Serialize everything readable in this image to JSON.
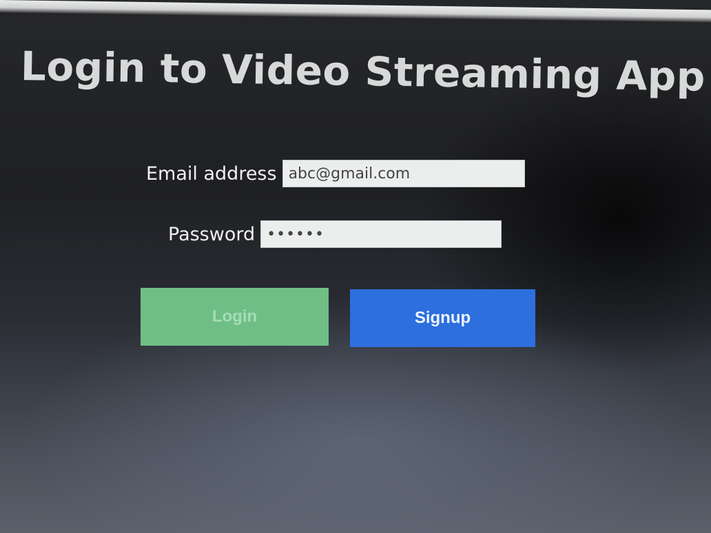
{
  "app": {
    "title": "Login to Video Streaming App"
  },
  "form": {
    "email": {
      "label": "Email address",
      "value": "abc@gmail.com"
    },
    "password": {
      "label": "Password",
      "value": "••••••"
    }
  },
  "buttons": {
    "login_label": "Login",
    "signup_label": "Signup"
  },
  "colors": {
    "login_button": "#6fbe86",
    "signup_button": "#2c6fdd",
    "background": "#1f2023"
  }
}
